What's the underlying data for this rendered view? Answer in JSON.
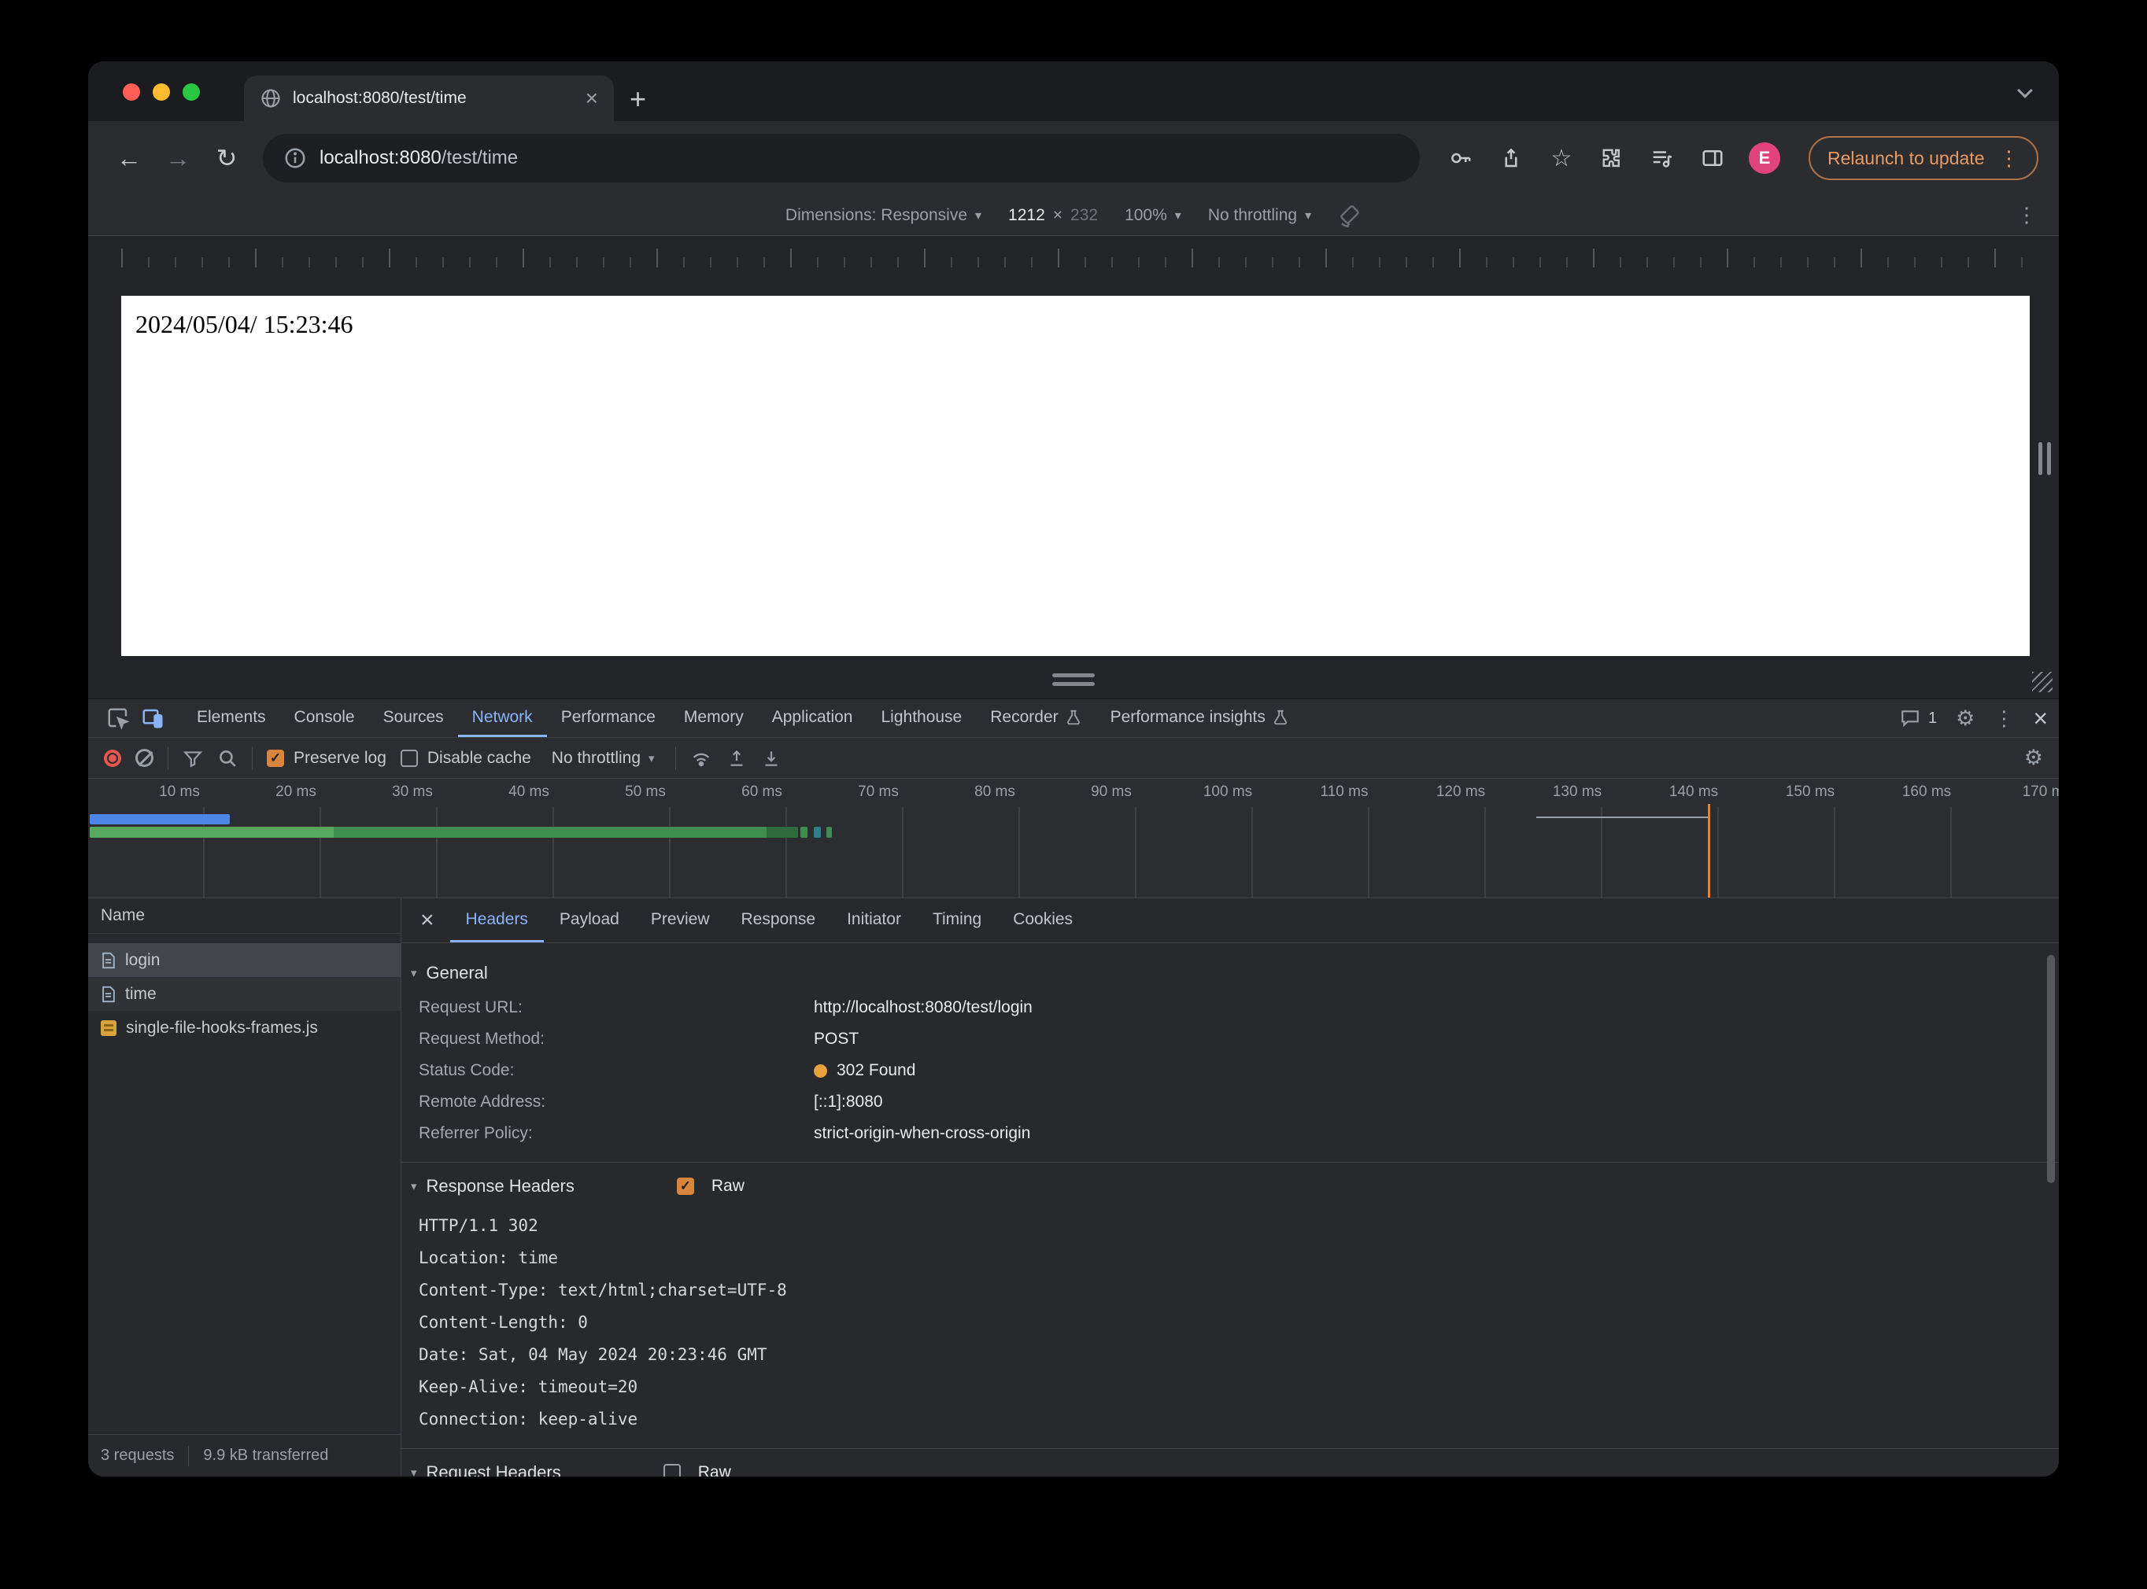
{
  "tab_strip": {
    "tab_title": "localhost:8080/test/time"
  },
  "toolbar": {
    "url_host": "localhost:8080",
    "url_path": "/test/time",
    "relaunch_label": "Relaunch to update",
    "avatar_letter": "E"
  },
  "device_bar": {
    "dimensions_label": "Dimensions: Responsive",
    "width_value": "1212",
    "times_symbol": "×",
    "height_value": "232",
    "zoom_value": "100%",
    "throttle_value": "No throttling"
  },
  "page": {
    "body_text": "2024/05/04/ 15:23:46"
  },
  "devtools": {
    "badge_count": "1",
    "tabs": [
      "Elements",
      "Console",
      "Sources",
      "Network",
      "Performance",
      "Memory",
      "Application",
      "Lighthouse",
      "Recorder",
      "Performance insights"
    ],
    "network_toolbar": {
      "preserve_log_label": "Preserve log",
      "disable_cache_label": "Disable cache",
      "throttle_value": "No throttling"
    },
    "timeline_labels": [
      "10 ms",
      "20 ms",
      "30 ms",
      "40 ms",
      "50 ms",
      "60 ms",
      "70 ms",
      "80 ms",
      "90 ms",
      "100 ms",
      "110 ms",
      "120 ms",
      "130 ms",
      "140 ms",
      "150 ms",
      "160 ms",
      "170 m"
    ],
    "requests": {
      "name_header": "Name",
      "items": [
        {
          "name": "login"
        },
        {
          "name": "time"
        },
        {
          "name": "single-file-hooks-frames.js"
        }
      ],
      "footer_requests": "3 requests",
      "footer_transferred": "9.9 kB transferred"
    },
    "detail": {
      "tabs": [
        "Headers",
        "Payload",
        "Preview",
        "Response",
        "Initiator",
        "Timing",
        "Cookies"
      ],
      "general_title": "General",
      "rows": [
        {
          "label": "Request URL:",
          "value": "http://localhost:8080/test/login"
        },
        {
          "label": "Request Method:",
          "value": "POST"
        },
        {
          "label": "Status Code:",
          "value": "302 Found"
        },
        {
          "label": "Remote Address:",
          "value": "[::1]:8080"
        },
        {
          "label": "Referrer Policy:",
          "value": "strict-origin-when-cross-origin"
        }
      ],
      "response_headers_title": "Response Headers",
      "raw_label": "Raw",
      "raw_lines": [
        "HTTP/1.1 302",
        "Location: time",
        "Content-Type: text/html;charset=UTF-8",
        "Content-Length: 0",
        "Date: Sat, 04 May 2024 20:23:46 GMT",
        "Keep-Alive: timeout=20",
        "Connection: keep-alive"
      ],
      "request_headers_title": "Request Headers"
    }
  },
  "icons": {
    "back": "←",
    "forward": "→",
    "reload": "↻",
    "star": "☆",
    "plus": "+",
    "close": "×",
    "kebab": "⋮",
    "dropdown": "▾",
    "expander": "▾",
    "check": "✓"
  },
  "colors": {
    "accent_blue": "#8ab4f8",
    "accent_orange": "#d7863c",
    "status_orange": "#e8a13c",
    "record_red": "#e4564e",
    "avatar_pink": "#e1447c"
  }
}
